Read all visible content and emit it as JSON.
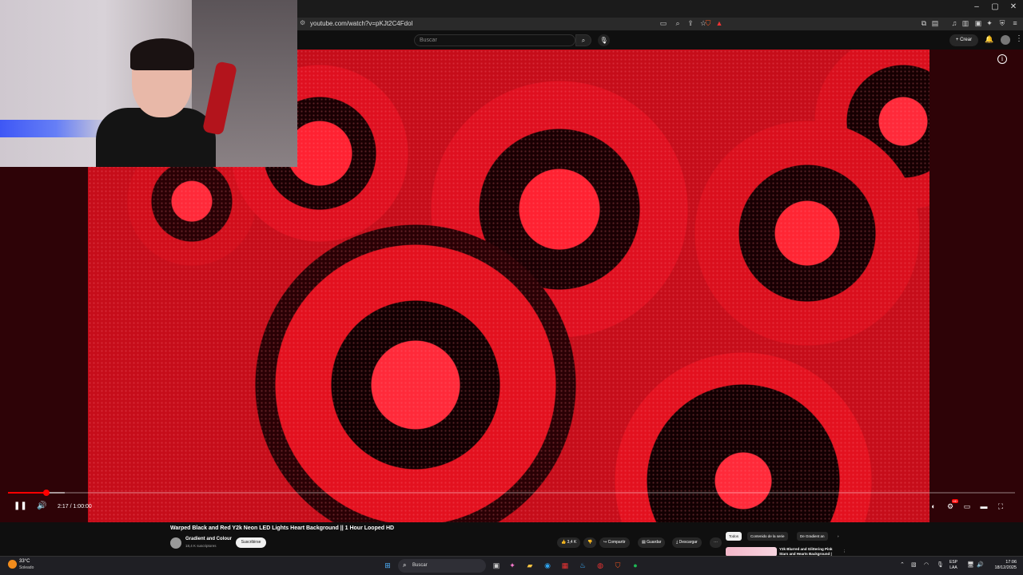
{
  "window": {
    "min": "–",
    "max": "▢",
    "close": "✕"
  },
  "address_bar": {
    "url": "youtube.com/watch?v=pKJt2C4Fdol"
  },
  "youtube_header": {
    "search_placeholder": "Buscar",
    "create_label": "Crear"
  },
  "player": {
    "time": "2:17 / 1:00:00",
    "played_fraction": 0.0381,
    "buffered_fraction": 0.056
  },
  "video": {
    "title": "Warped Black and Red Y2k Neon LED Lights Heart Background || 1 Hour Looped HD",
    "channel": "Gradient and Colour",
    "subscribers": "18,4 K suscriptores",
    "subscribe_label": "Suscribirse",
    "likes": "3,4 K",
    "share_label": "Compartir",
    "save_label": "Guardar",
    "download_label": "Descargar"
  },
  "chips": [
    "Todos",
    "Contenido de la serie",
    "De Gradient an"
  ],
  "recommendation": {
    "title": "Y2k Blurred and Glittering Pink Stars and Hearts Background |"
  },
  "taskbar": {
    "temp": "33°C",
    "weather": "Soleado",
    "search_placeholder": "Buscar",
    "lang_line1": "ESP",
    "lang_line2": "LAA",
    "time": "17:06",
    "date": "18/12/2025"
  },
  "colors": {
    "accent": "#ff0000",
    "video_bg": "#c60d1a",
    "page_bg": "#0f0f0f"
  }
}
